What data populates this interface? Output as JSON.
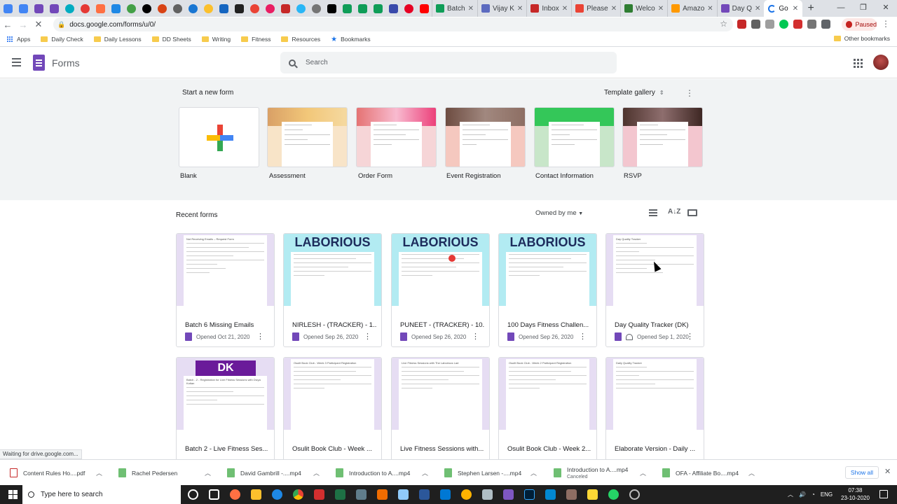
{
  "colors": {
    "forms_purple": "#7248b9",
    "laborious_band": "#b2ebf2",
    "lavender_band": "#e6ddf3",
    "blue": "#1a73e8",
    "template_bg": "#f1f3f4"
  },
  "browser": {
    "tabs": [
      {
        "label": "Batch",
        "icon": "sheets-icon"
      },
      {
        "label": "Vijay K",
        "icon": "vk-icon"
      },
      {
        "label": "Inbox",
        "icon": "mail-icon"
      },
      {
        "label": "Please",
        "icon": "gmail-icon"
      },
      {
        "label": "Welco",
        "icon": "welcome-icon"
      },
      {
        "label": "Amazo",
        "icon": "amazon-icon"
      },
      {
        "label": "Day Q",
        "icon": "forms-icon"
      }
    ],
    "active_tab": {
      "label": "Go"
    },
    "url": "docs.google.com/forms/u/0/",
    "paused_label": "Paused",
    "bookmarks": [
      {
        "label": "Apps",
        "icon": "apps-icon"
      },
      {
        "label": "Daily Check",
        "icon": "folder-icon"
      },
      {
        "label": "Daily Lessons",
        "icon": "folder-icon"
      },
      {
        "label": "DD Sheets",
        "icon": "folder-icon"
      },
      {
        "label": "Writing",
        "icon": "folder-icon"
      },
      {
        "label": "Fitness",
        "icon": "folder-icon"
      },
      {
        "label": "Resources",
        "icon": "folder-icon"
      },
      {
        "label": "Bookmarks",
        "icon": "star-icon"
      }
    ],
    "other_bookmarks": "Other bookmarks",
    "status": "Waiting for drive.google.com..."
  },
  "app": {
    "title": "Forms",
    "search_placeholder": "Search"
  },
  "templates": {
    "heading": "Start a new form",
    "gallery_label": "Template gallery",
    "items": [
      {
        "label": "Blank"
      },
      {
        "label": "Assessment"
      },
      {
        "label": "Order Form"
      },
      {
        "label": "Event Registration"
      },
      {
        "label": "Contact Information"
      },
      {
        "label": "RSVP"
      }
    ]
  },
  "recent": {
    "heading": "Recent forms",
    "owner_filter": "Owned by me",
    "forms": [
      {
        "name": "Batch 6 Missing Emails",
        "opened": "Opened Oct 21, 2020",
        "banner": ""
      },
      {
        "name": "NIRLESH - (TRACKER) - 1...",
        "opened": "Opened Sep 26, 2020",
        "banner": "LABORIOUS"
      },
      {
        "name": "PUNEET - (TRACKER) - 10...",
        "opened": "Opened Sep 26, 2020",
        "banner": "LABORIOUS"
      },
      {
        "name": "100 Days Fitness Challen...",
        "opened": "Opened Sep 26, 2020",
        "banner": "LABORIOUS"
      },
      {
        "name": "Day Quality Tracker (DK)",
        "opened": "Opened Sep 1, 2020",
        "banner": ""
      },
      {
        "name": "Batch 2 - Live Fitness Ses...",
        "opened": "",
        "banner": "DK"
      },
      {
        "name": "Osulit Book Club - Week ...",
        "opened": "",
        "banner": ""
      },
      {
        "name": "Live Fitness Sessions with...",
        "opened": "",
        "banner": ""
      },
      {
        "name": "Osulit Book Club - Week 2...",
        "opened": "",
        "banner": ""
      },
      {
        "name": "Elaborate Version - Daily ...",
        "opened": "",
        "banner": ""
      }
    ]
  },
  "downloads": [
    {
      "name": "Content Rules Ho....pdf",
      "status": ""
    },
    {
      "name": "Rachel Pedersen",
      "status": ""
    },
    {
      "name": "David Gambrill -....mp4",
      "status": ""
    },
    {
      "name": "Introduction to A....mp4",
      "status": ""
    },
    {
      "name": "Stephen Larsen -....mp4",
      "status": ""
    },
    {
      "name": "Introduction to A....mp4",
      "status": "Canceled"
    },
    {
      "name": "OFA - Affiliate Bo....mp4",
      "status": ""
    }
  ],
  "downloads_show_all": "Show all",
  "taskbar": {
    "search_placeholder": "Type here to search",
    "language": "ENG",
    "time": "07:38",
    "date": "23-10-2020"
  }
}
